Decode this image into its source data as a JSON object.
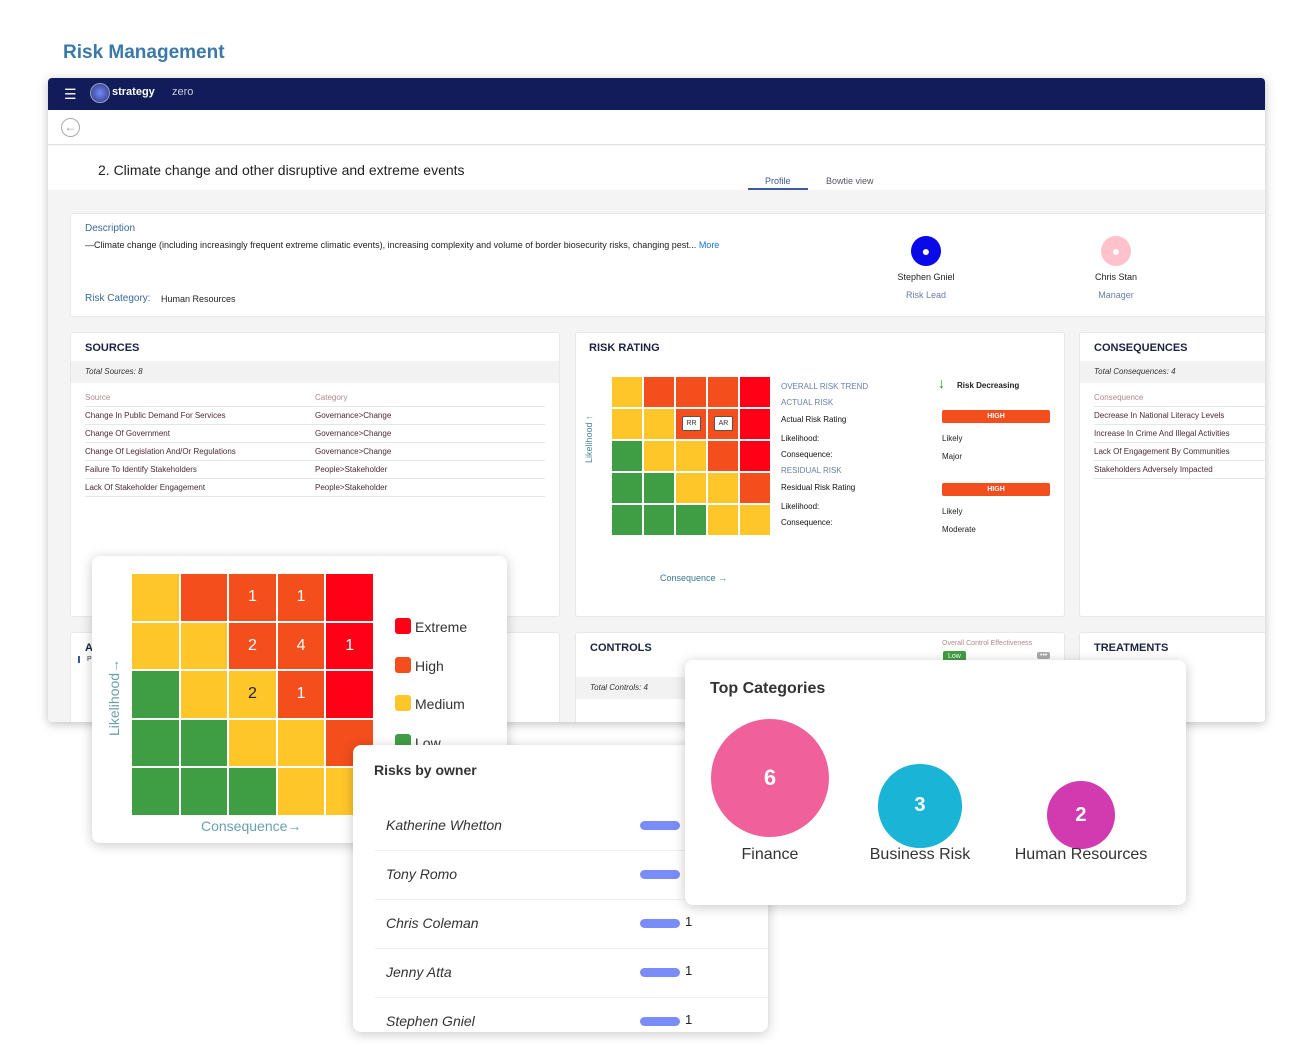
{
  "page_title": "Risk Management",
  "app": {
    "brand": "strategy",
    "brand_suffix": "zero",
    "menu_icon": "hamburger-icon",
    "back_icon": "arrow-left-icon"
  },
  "risk": {
    "title": "2. Climate change and other disruptive and extreme events",
    "tabs": [
      {
        "label": "Profile",
        "active": true
      },
      {
        "label": "Bowtie view",
        "active": false
      }
    ],
    "description_label": "Description",
    "description": "—Climate change (including increasingly frequent extreme climatic events), increasing complexity and volume of border biosecurity risks, changing pest...",
    "more": "More",
    "category_label": "Risk Category:",
    "category": "Human Resources",
    "people": [
      {
        "name": "Stephen Gniel",
        "role": "Risk Lead",
        "color": "#0a0ae8"
      },
      {
        "name": "Chris Stan",
        "role": "Manager",
        "color": "#ffc2cc"
      }
    ]
  },
  "sources": {
    "title": "SOURCES",
    "total": "Total Sources: 8",
    "headers": [
      "Source",
      "Category"
    ],
    "rows": [
      [
        "Change In Public Demand For Services",
        "Governance>Change"
      ],
      [
        "Change Of Government",
        "Governance>Change"
      ],
      [
        "Change Of Legislation And/Or Regulations",
        "Governance>Change"
      ],
      [
        "Failure To Identify Stakeholders",
        "People>Stakeholder"
      ],
      [
        "Lack Of Stakeholder Engagement",
        "People>Stakeholder"
      ]
    ]
  },
  "rating": {
    "title": "RISK RATING",
    "ylabel": "Likelihood ↑",
    "xlabel": "Consequence →",
    "markers": {
      "RR": [
        1,
        2
      ],
      "AR": [
        1,
        3
      ]
    },
    "trend_label": "OVERALL RISK TREND",
    "trend": "Risk Decreasing",
    "actual_label": "ACTUAL RISK",
    "actual_rating_label": "Actual Risk Rating",
    "actual_rating": "HIGH",
    "actual_likelihood": "Likely",
    "actual_consequence": "Major",
    "residual_label": "RESIDUAL RISK",
    "residual_rating_label": "Residual Risk Rating",
    "residual_rating": "HIGH",
    "residual_likelihood": "Likely",
    "residual_consequence": "Moderate",
    "likelihood_label": "Likelihood:",
    "consequence_label": "Consequence:"
  },
  "matrix_levels": [
    [
      "M",
      "H",
      "H",
      "H",
      "E"
    ],
    [
      "M",
      "M",
      "H",
      "H",
      "E"
    ],
    [
      "L",
      "M",
      "M",
      "H",
      "E"
    ],
    [
      "L",
      "L",
      "M",
      "M",
      "H"
    ],
    [
      "L",
      "L",
      "L",
      "M",
      "M"
    ]
  ],
  "colors": {
    "E": "#ff0016",
    "H": "#f44e1c",
    "M": "#ffc629",
    "L": "#3f9e44"
  },
  "consequences": {
    "title": "CONSEQUENCES",
    "total": "Total Consequences: 4",
    "header": "Consequence",
    "rows": [
      "Decrease In National Literacy Levels",
      "Increase In Crime And Illegal Activities",
      "Lack Of Engagement By Communities",
      "Stakeholders Adversely Impacted"
    ]
  },
  "controls": {
    "title": "CONTROLS",
    "effectiveness_label": "Overall Control Effectiveness",
    "effectiveness": "Low",
    "total": "Total Controls: 4"
  },
  "treatments": {
    "title": "TREATMENTS"
  },
  "hidden_card": {
    "title_fragment": "A",
    "sub_fragment": "Pr"
  },
  "heatmap": {
    "ylabel": "Likelihood→",
    "xlabel": "Consequence→",
    "counts": [
      [
        null,
        null,
        1,
        1,
        null
      ],
      [
        null,
        null,
        2,
        4,
        1
      ],
      [
        null,
        null,
        2,
        1,
        null
      ],
      [
        null,
        null,
        null,
        null,
        null
      ],
      [
        null,
        null,
        null,
        null,
        null
      ]
    ],
    "legend": [
      {
        "key": "E",
        "label": "Extreme"
      },
      {
        "key": "H",
        "label": "High"
      },
      {
        "key": "M",
        "label": "Medium"
      },
      {
        "key": "L",
        "label": "Low"
      }
    ]
  },
  "owners": {
    "title": "Risks by owner",
    "rows": [
      {
        "name": "Katherine Whetton",
        "count": null
      },
      {
        "name": "Tony Romo",
        "count": null
      },
      {
        "name": "Chris Coleman",
        "count": 1
      },
      {
        "name": "Jenny Atta",
        "count": 1
      },
      {
        "name": "Stephen Gniel",
        "count": 1
      }
    ]
  },
  "top_categories": {
    "title": "Top Categories",
    "items": [
      {
        "label": "Finance",
        "value": 6,
        "color": "#f0609a"
      },
      {
        "label": "Business Risk",
        "value": 3,
        "color": "#19b4d6"
      },
      {
        "label": "Human Resources",
        "value": 2,
        "color": "#d23ab0"
      }
    ]
  }
}
